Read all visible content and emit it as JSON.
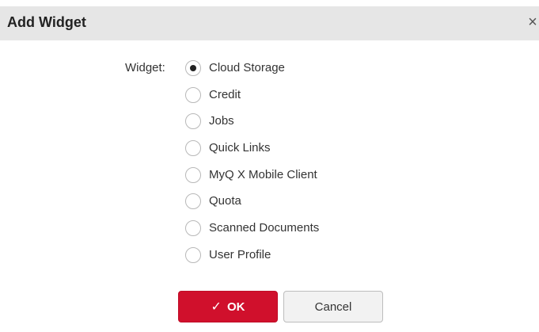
{
  "dialog": {
    "title": "Add Widget",
    "close_glyph": "×"
  },
  "form": {
    "label": "Widget:",
    "selected": "Cloud Storage",
    "options": [
      {
        "label": "Cloud Storage",
        "checked": true
      },
      {
        "label": "Credit",
        "checked": false
      },
      {
        "label": "Jobs",
        "checked": false
      },
      {
        "label": "Quick Links",
        "checked": false
      },
      {
        "label": "MyQ X Mobile Client",
        "checked": false
      },
      {
        "label": "Quota",
        "checked": false
      },
      {
        "label": "Scanned Documents",
        "checked": false
      },
      {
        "label": "User Profile",
        "checked": false
      }
    ]
  },
  "buttons": {
    "ok_icon": "✓",
    "ok_label": "OK",
    "cancel_label": "Cancel"
  },
  "colors": {
    "titlebar_bg": "#e6e6e6",
    "ok_bg": "#d0102c",
    "cancel_bg": "#f2f2f2"
  }
}
